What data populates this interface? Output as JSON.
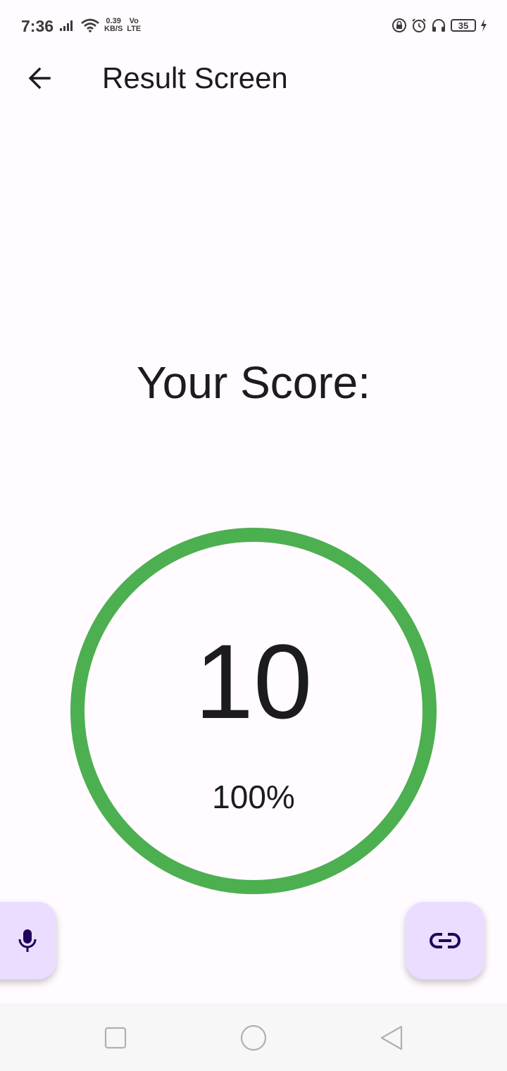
{
  "status_bar": {
    "time": "7:36",
    "net_speed_value": "0.39",
    "net_speed_unit": "KB/S",
    "volte_top": "Vo",
    "volte_bottom": "LTE",
    "battery_level": "35"
  },
  "app_bar": {
    "title": "Result Screen",
    "back_icon": "arrow-back-icon"
  },
  "score": {
    "heading": "Your Score:",
    "value": "10",
    "percent_label": "100%",
    "progress_fraction": 1.0,
    "ring_color": "#4caf50"
  },
  "fabs": {
    "left_icon": "mic-icon",
    "right_icon": "link-icon",
    "background": "#eaddff"
  },
  "nav_bar": {
    "buttons": [
      "recents-icon",
      "home-icon",
      "back-icon"
    ]
  }
}
